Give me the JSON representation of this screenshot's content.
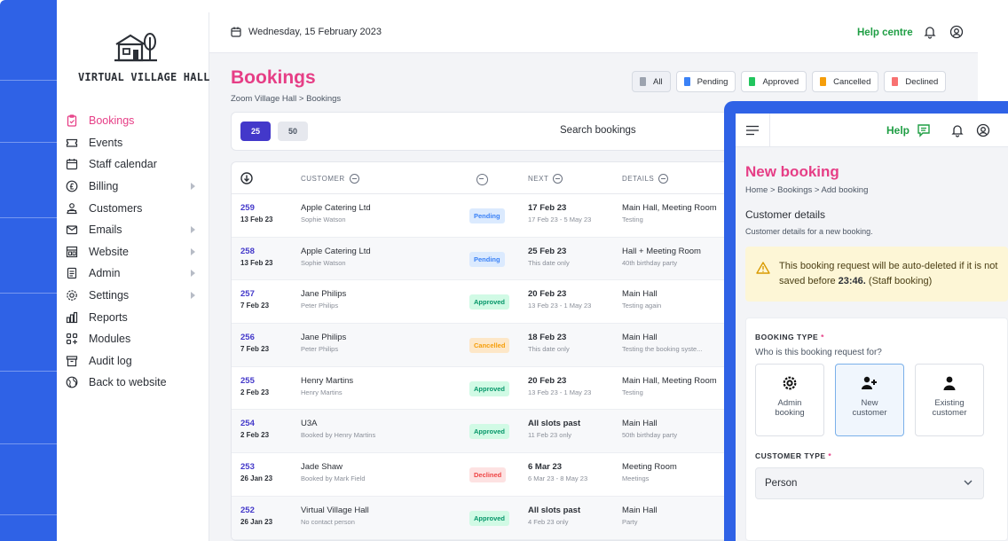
{
  "brand": {
    "name": "VIRTUAL VILLAGE HALL"
  },
  "topbar": {
    "date": "Wednesday, 15 February 2023",
    "help": "Help centre"
  },
  "nav": [
    {
      "label": "Bookings",
      "icon": "clipboard-icon",
      "active": true,
      "chevron": false
    },
    {
      "label": "Events",
      "icon": "ticket-icon",
      "active": false,
      "chevron": false
    },
    {
      "label": "Staff calendar",
      "icon": "calendar-icon",
      "active": false,
      "chevron": false
    },
    {
      "label": "Billing",
      "icon": "coin-icon",
      "active": false,
      "chevron": true
    },
    {
      "label": "Customers",
      "icon": "users-icon",
      "active": false,
      "chevron": false
    },
    {
      "label": "Emails",
      "icon": "mail-icon",
      "active": false,
      "chevron": true
    },
    {
      "label": "Website",
      "icon": "layout-icon",
      "active": false,
      "chevron": true
    },
    {
      "label": "Admin",
      "icon": "file-icon",
      "active": false,
      "chevron": true
    },
    {
      "label": "Settings",
      "icon": "gear-icon",
      "active": false,
      "chevron": true
    },
    {
      "label": "Reports",
      "icon": "bar-chart-icon",
      "active": false,
      "chevron": false
    },
    {
      "label": "Modules",
      "icon": "modules-icon",
      "active": false,
      "chevron": false
    },
    {
      "label": "Audit log",
      "icon": "archive-icon",
      "active": false,
      "chevron": false
    },
    {
      "label": "Back to website",
      "icon": "globe-icon",
      "active": false,
      "chevron": false
    }
  ],
  "page": {
    "title": "Bookings",
    "breadcrumb": "Zoom Village Hall  >  Bookings"
  },
  "filters": [
    {
      "label": "All",
      "color": "#9ca3af"
    },
    {
      "label": "Pending",
      "color": "#3b82f6"
    },
    {
      "label": "Approved",
      "color": "#22c55e"
    },
    {
      "label": "Cancelled",
      "color": "#f59e0b"
    },
    {
      "label": "Declined",
      "color": "#f87171"
    }
  ],
  "toolbar": {
    "page_size_a": "25",
    "page_size_b": "50",
    "search": "Search bookings"
  },
  "table": {
    "headers": {
      "customer": "CUSTOMER",
      "next": "NEXT",
      "details": "DETAILS"
    },
    "rows": [
      {
        "id": "259",
        "date": "13 Feb 23",
        "customer": "Apple Catering Ltd",
        "contact": "Sophie Watson",
        "status": "Pending",
        "next": "17 Feb 23",
        "next_sub": "17 Feb 23 - 5 May 23",
        "details": "Main Hall, Meeting Room",
        "details_sub": "Testing"
      },
      {
        "id": "258",
        "date": "13 Feb 23",
        "customer": "Apple Catering Ltd",
        "contact": "Sophie Watson",
        "status": "Pending",
        "next": "25 Feb 23",
        "next_sub": "This date only",
        "details": "Hall + Meeting Room",
        "details_sub": "40th birthday party"
      },
      {
        "id": "257",
        "date": "7 Feb 23",
        "customer": "Jane Philips",
        "contact": "Peter Philips",
        "status": "Approved",
        "next": "20 Feb 23",
        "next_sub": "13 Feb 23 - 1 May 23",
        "details": "Main Hall",
        "details_sub": "Testing again"
      },
      {
        "id": "256",
        "date": "7 Feb 23",
        "customer": "Jane Philips",
        "contact": "Peter Philips",
        "status": "Cancelled",
        "next": "18 Feb 23",
        "next_sub": "This date only",
        "details": "Main Hall",
        "details_sub": "Testing the booking syste..."
      },
      {
        "id": "255",
        "date": "2 Feb 23",
        "customer": "Henry Martins",
        "contact": "Henry Martins",
        "status": "Approved",
        "next": "20 Feb 23",
        "next_sub": "13 Feb 23 - 1 May 23",
        "details": "Main Hall, Meeting Room",
        "details_sub": "Testing"
      },
      {
        "id": "254",
        "date": "2 Feb 23",
        "customer": "U3A",
        "contact": "Booked by Henry Martins",
        "status": "Approved",
        "next": "All slots past",
        "next_sub": "11 Feb 23 only",
        "details": "Main Hall",
        "details_sub": "50th birthday party"
      },
      {
        "id": "253",
        "date": "26 Jan 23",
        "customer": "Jade Shaw",
        "contact": "Booked by Mark Field",
        "status": "Declined",
        "next": "6 Mar 23",
        "next_sub": "6 Mar 23 - 8 May 23",
        "details": "Meeting Room",
        "details_sub": "Meetings"
      },
      {
        "id": "252",
        "date": "26 Jan 23",
        "customer": "Virtual Village Hall",
        "contact": "No contact person",
        "status": "Approved",
        "next": "All slots past",
        "next_sub": "4 Feb 23 only",
        "details": "Main Hall",
        "details_sub": "Party"
      }
    ]
  },
  "panel": {
    "help": "Help",
    "title": "New booking",
    "breadcrumb": "Home  >  Bookings  >  Add booking",
    "section_title": "Customer details",
    "section_sub": "Customer details for a new booking.",
    "warning_pre": "This booking request will be auto-deleted if it is not saved before ",
    "warning_time": "23:46.",
    "warning_post": " (Staff booking)",
    "booking_type_label": "BOOKING TYPE",
    "booking_type_question": "Who is this booking request for?",
    "options": [
      {
        "line1": "Admin",
        "line2": "booking",
        "icon": "gear-icon",
        "selected": false
      },
      {
        "line1": "New",
        "line2": "customer",
        "icon": "add-user-icon",
        "selected": true
      },
      {
        "line1": "Existing",
        "line2": "customer",
        "icon": "user-icon",
        "selected": false
      }
    ],
    "customer_type_label": "CUSTOMER TYPE",
    "customer_type_value": "Person"
  }
}
